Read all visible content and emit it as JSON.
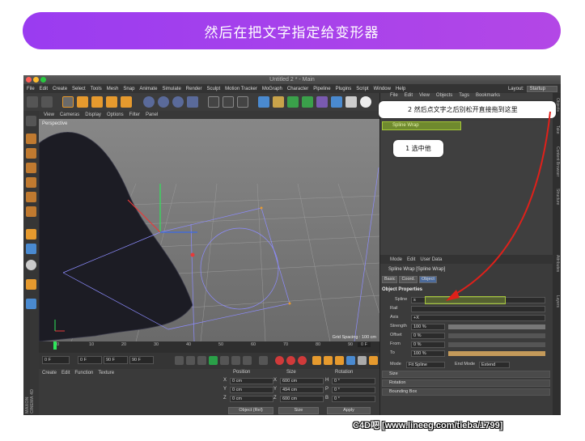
{
  "banner": {
    "title": "然后在把文字指定给变形器"
  },
  "window": {
    "title": "Untitled 2 * - Main",
    "layout_label": "Layout:",
    "layout_value": "Startup"
  },
  "menubar": [
    "File",
    "Edit",
    "Create",
    "Select",
    "Tools",
    "Mesh",
    "Snap",
    "Animate",
    "Simulate",
    "Render",
    "Sculpt",
    "Motion Tracker",
    "MoGraph",
    "Character",
    "Pipeline",
    "Plugins",
    "Script",
    "Window",
    "Help"
  ],
  "viewport": {
    "menu": [
      "View",
      "Cameras",
      "Display",
      "Options",
      "Filter",
      "Panel"
    ],
    "label": "Perspective",
    "grid_spacing": "Grid Spacing : 100 cm"
  },
  "timeline": {
    "ticks": [
      "0",
      "10",
      "20",
      "30",
      "40",
      "50",
      "60",
      "70",
      "80",
      "90"
    ],
    "current_frame": "0 F",
    "start": "0 F",
    "min": "0 F",
    "max": "90 F",
    "end": "90 F"
  },
  "material_panel": {
    "menu": [
      "Create",
      "Edit",
      "Function",
      "Texture"
    ]
  },
  "logo": "MAXON CINEMA 4D",
  "coordinates": {
    "headers": [
      "Position",
      "Size",
      "Rotation"
    ],
    "rows": [
      {
        "axis": "X",
        "pos": "0 cm",
        "size_axis": "X",
        "size": "600 cm",
        "rot_axis": "H",
        "rot": "0 °"
      },
      {
        "axis": "Y",
        "pos": "0 cm",
        "size_axis": "Y",
        "size": "494 cm",
        "rot_axis": "P",
        "rot": "0 °"
      },
      {
        "axis": "Z",
        "pos": "0 cm",
        "size_axis": "Z",
        "size": "600 cm",
        "rot_axis": "B",
        "rot": "0 °"
      }
    ],
    "mode": "Object (Rel)",
    "size_mode": "Size",
    "apply": "Apply"
  },
  "object_manager": {
    "menu": [
      "File",
      "Edit",
      "View",
      "Objects",
      "Tags",
      "Bookmarks"
    ],
    "object_name": "Spline Wrap"
  },
  "callouts": {
    "step2": "2 然后点文字之后别松开直接拖到这里",
    "step1": "1 选中他"
  },
  "side_tabs": [
    "Objects",
    "Take",
    "Content Browser",
    "Structure",
    "Attributes",
    "Layers"
  ],
  "attributes": {
    "menu": [
      "Mode",
      "Edit",
      "User Data"
    ],
    "title": "Spline Wrap [Spline Wrap]",
    "tabs": [
      "Basic",
      "Coord.",
      "Object"
    ],
    "section": "Object Properties",
    "spline_label": "Spline",
    "spline_value": "s",
    "rail_label": "Rail",
    "axis_label": "Axis",
    "axis_value": "+X",
    "strength_label": "Strength",
    "strength_value": "100 %",
    "offset_label": "Offset",
    "offset_value": "0 %",
    "from_label": "From",
    "from_value": "0 %",
    "to_label": "To",
    "to_value": "100 %",
    "mode_label": "Mode",
    "mode_value": "Fit Spline",
    "endmode_label": "End Mode",
    "endmode_value": "Extend",
    "groups": [
      "Size",
      "Rotation",
      "Bounding Box"
    ]
  },
  "watermark": "C4D吧  [www.lineeg.com/tieba/1799]",
  "colors": {
    "banner": "#a640ec",
    "highlight": "#a4c639",
    "arrow": "#e0201a"
  }
}
